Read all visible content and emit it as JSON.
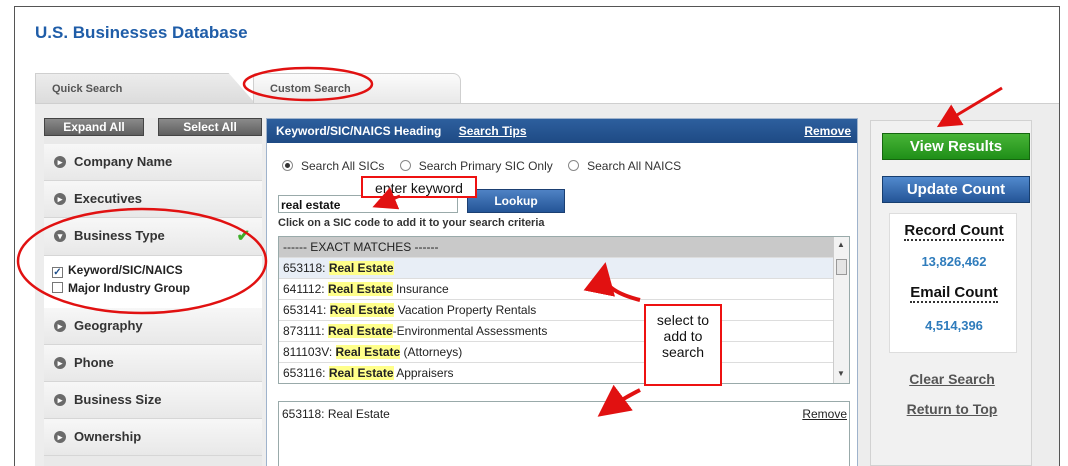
{
  "app_title": "U.S. Businesses Database",
  "tabs": [
    {
      "label": "Quick Search"
    },
    {
      "label": "Custom Search"
    }
  ],
  "left_panel": {
    "expand_all": "Expand All",
    "select_all": "Select All",
    "categories": [
      {
        "label": "Company Name"
      },
      {
        "label": "Executives"
      },
      {
        "label": "Business Type"
      },
      {
        "label": "Geography"
      },
      {
        "label": "Phone"
      },
      {
        "label": "Business Size"
      },
      {
        "label": "Ownership"
      }
    ],
    "business_type_options": [
      {
        "label": "Keyword/SIC/NAICS",
        "checked": true
      },
      {
        "label": "Major Industry Group",
        "checked": false
      }
    ]
  },
  "middle_panel": {
    "heading": "Keyword/SIC/NAICS Heading",
    "search_tips": "Search Tips",
    "remove": "Remove",
    "radio_options": [
      {
        "label": "Search All SICs",
        "selected": true
      },
      {
        "label": "Search Primary SIC Only",
        "selected": false
      },
      {
        "label": "Search All NAICS",
        "selected": false
      }
    ],
    "keyword_value": "real estate",
    "lookup_label": "Lookup",
    "hint": "Click on a SIC code to add it to your search criteria",
    "results_header": "------ EXACT MATCHES ------",
    "results": [
      {
        "code": "653118: ",
        "match": "Real Estate",
        "rest": ""
      },
      {
        "code": "641112: ",
        "match": "Real Estate",
        "rest": " Insurance"
      },
      {
        "code": "653141: ",
        "match": "Real Estate",
        "rest": " Vacation Property Rentals"
      },
      {
        "code": "873111: ",
        "match": "Real Estate",
        "rest": "-Environmental Assessments"
      },
      {
        "code": "811103V: ",
        "match": "Real Estate",
        "rest": " (Attorneys)"
      },
      {
        "code": "653116: ",
        "match": "Real Estate",
        "rest": " Appraisers"
      }
    ],
    "selected_item": "653118: Real Estate",
    "selected_remove": "Remove"
  },
  "right_panel": {
    "view_results": "View Results",
    "update_count": "Update Count",
    "record_count_label": "Record Count",
    "record_count_value": "13,826,462",
    "email_count_label": "Email Count",
    "email_count_value": "4,514,396",
    "clear_search": "Clear Search",
    "return_to_top": "Return to Top"
  },
  "annotations": {
    "enter_keyword": "enter keyword",
    "select_to_add": [
      "select to",
      "add to",
      "search"
    ],
    "color": "#e11111"
  },
  "colors": {
    "brand_blue": "#1f5da8",
    "header_blue": "#1e4a84",
    "green_button": "#1f8f18",
    "highlight": "#ffff8a"
  }
}
